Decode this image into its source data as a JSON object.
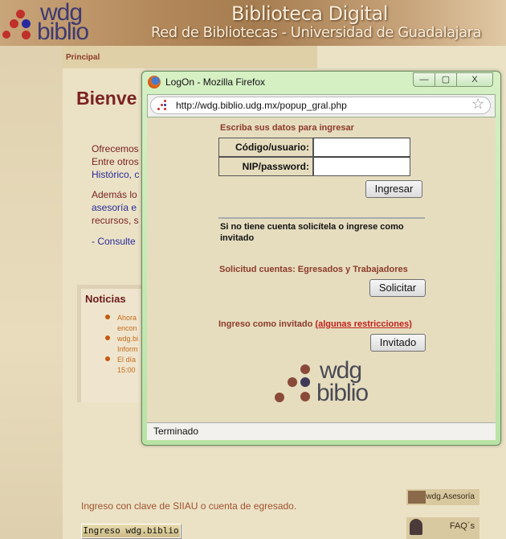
{
  "header": {
    "logo_top": "wdg",
    "logo_bottom": "biblio",
    "title": "Biblioteca Digital",
    "subtitle": "Red de Bibliotecas - Universidad de Guadalajara"
  },
  "nav": {
    "principal": "Principal"
  },
  "main": {
    "welcome": "Bienve",
    "lines": [
      "Ofrecemos",
      "Entre otros",
      "Histórico, c",
      "Además lo",
      "asesoría e",
      "recursos, s",
      "- Consulte"
    ]
  },
  "news": {
    "title": "Noticias",
    "items": [
      [
        "Ahora",
        "encon"
      ],
      [
        "wdg.bi",
        "Inform"
      ],
      [
        "El día",
        "15:00"
      ]
    ]
  },
  "popup": {
    "title": "LogOn - Mozilla Firefox",
    "url": "http://wdg.biblio.udg.mx/popup_gral.php",
    "prompt": "Escriba sus datos para ingresar",
    "user_label": "Código/usuario:",
    "user_value": "",
    "pass_label": "NIP/password:",
    "pass_value": "",
    "ingresar": "Ingresar",
    "no_account": "Si no tiene cuenta solicítela o ingrese como invitado",
    "solicitud": "Solicitud cuentas: Egresados y Trabajadores",
    "solicitar": "Solicitar",
    "guest": "Ingreso como invitado",
    "restrictions": "(algunas restricciones)",
    "invitado": "Invitado",
    "logo_top": "wdg",
    "logo_bottom": "biblio",
    "status": "Terminado",
    "min": "—",
    "max": "▢",
    "close": "X"
  },
  "footer": {
    "siiau": "Ingreso con clave de SIIAU o cuenta de egresado.",
    "ingreso_button": "Ingreso wdg.biblio",
    "asesoria": "wdg.Asesoría",
    "faqs": "FAQ´s"
  }
}
